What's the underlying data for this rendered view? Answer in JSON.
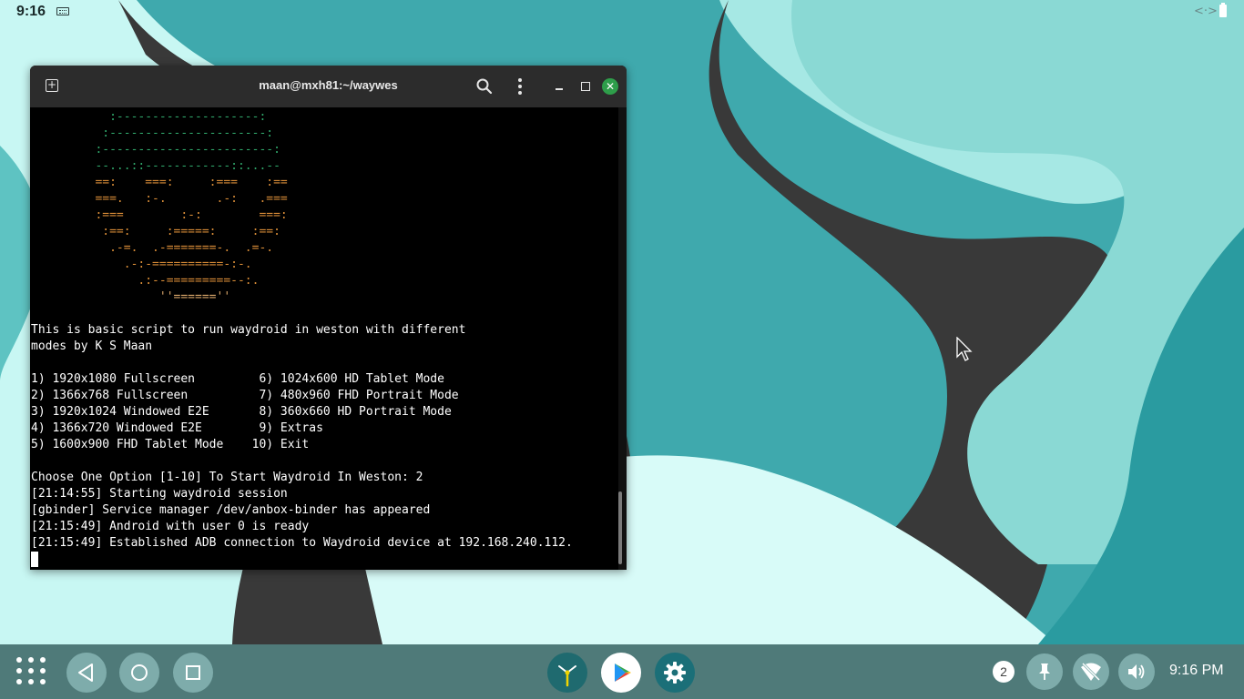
{
  "status_bar": {
    "time": "9:16",
    "icons": [
      "keyboard-icon",
      "link-icon",
      "battery-icon"
    ]
  },
  "terminal": {
    "title": "maan@mxh81:~/waywes",
    "buttons": [
      "new-tab-icon",
      "search-icon",
      "menu-icon",
      "minimize-icon",
      "maximize-icon",
      "close-icon"
    ],
    "ascii_art": [
      "           :--------------------:",
      "          :----------------------:",
      "         :------------------------:",
      "         --...::------------::...--",
      "         ==:    ===:     :===    :==",
      "         ===.   :-.       .-:   .===",
      "         :===        :-:        ===:",
      "          :==:     :=====:     :==:",
      "           .-=.  .-=======-.  .=-.",
      "             .-:-==========-:-.",
      "               .:--=========--:.",
      "                  ''======''"
    ],
    "intro": [
      "This is basic script to run waydroid in weston with different",
      "modes by K S Maan"
    ],
    "menu": [
      "1) 1920x1080 Fullscreen         6) 1024x600 HD Tablet Mode",
      "2) 1366x768 Fullscreen          7) 480x960 FHD Portrait Mode",
      "3) 1920x1024 Windowed E2E       8) 360x660 HD Portrait Mode",
      "4) 1366x720 Windowed E2E        9) Extras",
      "5) 1600x900 FHD Tablet Mode    10) Exit"
    ],
    "log": [
      "Choose One Option [1-10] To Start Waydroid In Weston: 2",
      "[21:14:55] Starting waydroid session",
      "[gbinder] Service manager /dev/anbox-binder has appeared",
      "[21:15:49] Android with user 0 is ready",
      "[21:15:49] Established ADB connection to Waydroid device at 192.168.240.112."
    ]
  },
  "taskbar": {
    "nav": [
      "apps-grid-icon",
      "back-icon",
      "home-icon",
      "recents-icon"
    ],
    "pinned_apps": [
      "clock-app-icon",
      "play-store-icon",
      "settings-app-icon"
    ],
    "notification_count": "2",
    "tray": [
      "pin-icon",
      "wifi-icon",
      "volume-icon"
    ],
    "clock": "9:16 PM"
  },
  "colors": {
    "terminal_bg": "#000000",
    "titlebar_bg": "#2c2c2c",
    "close_button": "#2e9e4a",
    "art_green": "#2fa66a",
    "art_orange": "#d88c37",
    "taskbar_bg": "#4f7a79",
    "wallpaper_teal": "#2e9aa0",
    "wallpaper_light": "#b4f2ee",
    "wallpaper_dark": "#3a3a3a"
  }
}
